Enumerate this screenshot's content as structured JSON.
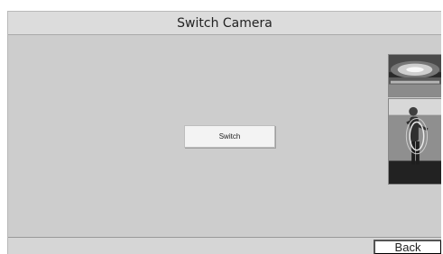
{
  "window": {
    "title": "Switch Camera"
  },
  "main": {
    "switch_label": "Switch"
  },
  "thumbnails": [
    {
      "icon": "camera-view-overhead-icon"
    },
    {
      "icon": "camera-view-person-icon"
    }
  ],
  "footer": {
    "back_label": "Back"
  }
}
